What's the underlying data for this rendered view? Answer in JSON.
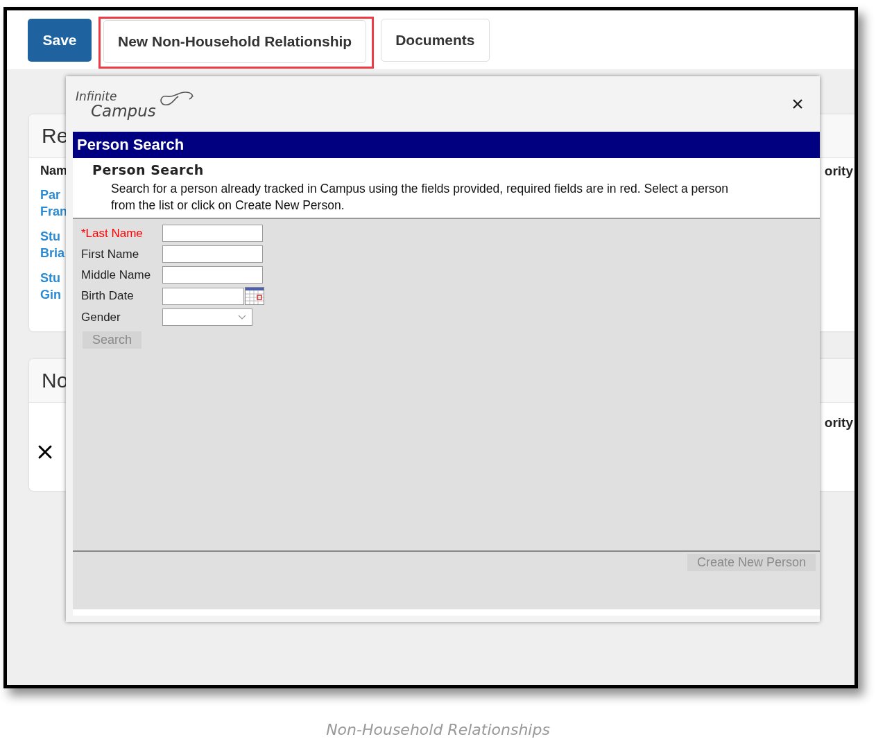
{
  "toolbar": {
    "buttons": [
      {
        "label": "Save",
        "kind": "primary",
        "highlighted": false
      },
      {
        "label": "New Non-Household Relationship",
        "kind": "secondary",
        "highlighted": true
      },
      {
        "label": "Documents",
        "kind": "secondary",
        "highlighted": false
      }
    ]
  },
  "background_cards": [
    {
      "kind": "list",
      "title": "Re",
      "column_header": "Nam",
      "right_header": "ority",
      "rows": [
        [
          "Par",
          "Fran"
        ],
        [
          "Stu",
          "Bria"
        ],
        [
          "Stu",
          "Gin"
        ]
      ]
    },
    {
      "kind": "removable",
      "title": "No",
      "right_header": "ority"
    }
  ],
  "modal": {
    "logo": {
      "line_1": "Infinite",
      "line_2": "Campus"
    },
    "title_bar": "Person Search",
    "heading": "Person Search",
    "description": "Search for a person already tracked in Campus using the fields provided, required fields are in red. Select a person from the list or click on Create New Person.",
    "fields": [
      {
        "label": "*Last Name",
        "required": true,
        "kind": "text"
      },
      {
        "label": "First Name",
        "required": false,
        "kind": "text"
      },
      {
        "label": "Middle Name",
        "required": false,
        "kind": "text"
      },
      {
        "label": "Birth Date",
        "required": false,
        "kind": "date"
      },
      {
        "label": "Gender",
        "required": false,
        "kind": "select"
      }
    ],
    "search_button": {
      "label": "Search",
      "disabled": true
    },
    "create_button": {
      "label": "Create New Person",
      "disabled": true
    }
  },
  "caption": "Non-Household Relationships"
}
